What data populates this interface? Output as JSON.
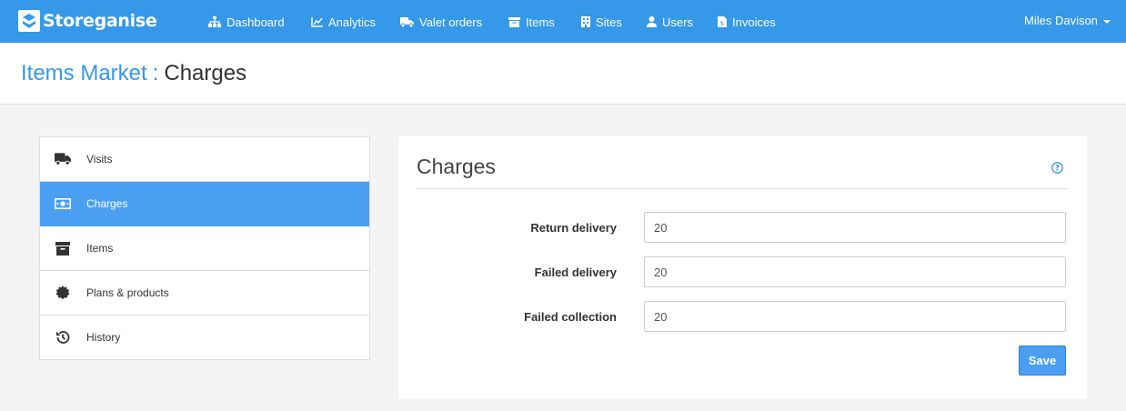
{
  "brand": {
    "name": "Storeganise"
  },
  "nav": {
    "items": [
      {
        "label": "Dashboard",
        "icon": "sitemap-icon"
      },
      {
        "label": "Analytics",
        "icon": "line-chart-icon"
      },
      {
        "label": "Valet orders",
        "icon": "truck-icon"
      },
      {
        "label": "Items",
        "icon": "archive-icon"
      },
      {
        "label": "Sites",
        "icon": "building-icon"
      },
      {
        "label": "Users",
        "icon": "user-icon"
      },
      {
        "label": "Invoices",
        "icon": "invoice-icon"
      }
    ],
    "user": "Miles Davison"
  },
  "breadcrumb": {
    "parent": "Items Market",
    "separator": ":",
    "current": "Charges"
  },
  "sidebar": {
    "items": [
      {
        "label": "Visits",
        "icon": "truck-icon",
        "active": false
      },
      {
        "label": "Charges",
        "icon": "money-icon",
        "active": true
      },
      {
        "label": "Items",
        "icon": "archive-icon",
        "active": false
      },
      {
        "label": "Plans & products",
        "icon": "certificate-icon",
        "active": false
      },
      {
        "label": "History",
        "icon": "history-icon",
        "active": false
      }
    ]
  },
  "panel": {
    "title": "Charges",
    "fields": [
      {
        "label": "Return delivery",
        "value": "20"
      },
      {
        "label": "Failed delivery",
        "value": "20"
      },
      {
        "label": "Failed collection",
        "value": "20"
      }
    ],
    "save_label": "Save"
  },
  "colors": {
    "primary": "#3598e8",
    "active": "#4b9ff2"
  }
}
